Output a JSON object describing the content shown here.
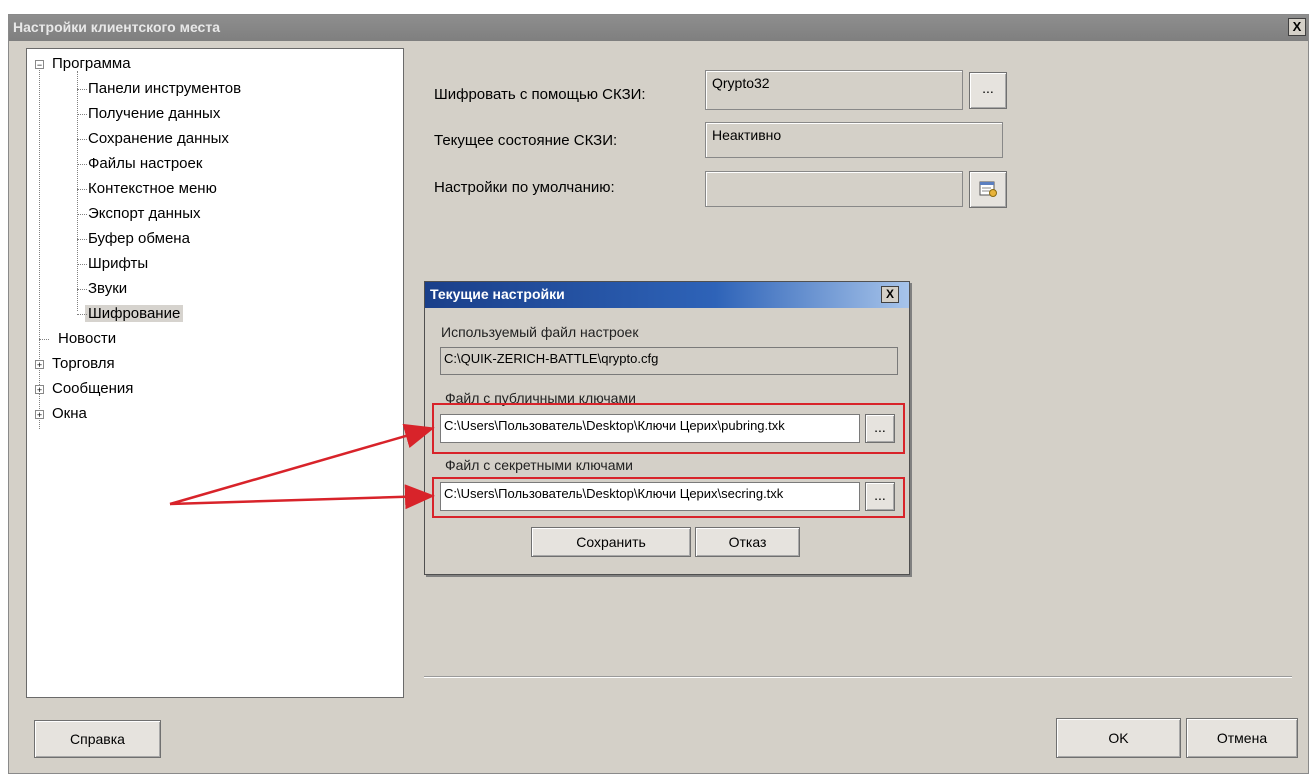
{
  "window": {
    "title": "Настройки клиентского места",
    "close_label": "X"
  },
  "tree": {
    "items": [
      {
        "label": "Программа",
        "expander": "−"
      },
      {
        "label": "Панели инструментов"
      },
      {
        "label": "Получение данных"
      },
      {
        "label": "Сохранение данных"
      },
      {
        "label": "Файлы настроек"
      },
      {
        "label": "Контекстное меню"
      },
      {
        "label": "Экспорт данных"
      },
      {
        "label": "Буфер обмена"
      },
      {
        "label": "Шрифты"
      },
      {
        "label": "Звуки"
      },
      {
        "label": "Шифрование",
        "selected": true
      },
      {
        "label": "Новости"
      },
      {
        "label": "Торговля",
        "expander": "+"
      },
      {
        "label": "Сообщения",
        "expander": "+"
      },
      {
        "label": "Окна",
        "expander": "+"
      }
    ]
  },
  "settings": {
    "encrypt_label": "Шифровать с помощью СКЗИ:",
    "encrypt_value": "Qrypto32",
    "browse_label": "...",
    "state_label": "Текущее состояние СКЗИ:",
    "state_value": "Неактивно",
    "default_label": "Настройки по умолчанию:",
    "default_value": "",
    "config_icon": "settings-card-icon"
  },
  "footer": {
    "help_label": "Справка",
    "ok_label": "OK",
    "cancel_label": "Отмена"
  },
  "dialog": {
    "title": "Текущие настройки",
    "close_label": "X",
    "used_file_label": "Используемый файл настроек",
    "used_file_value": "C:\\QUIK-ZERICH-BATTLE\\qrypto.cfg",
    "public_keys_label": "Файл с публичными ключами",
    "public_keys_value": "C:\\Users\\Пользователь\\Desktop\\Ключи Церих\\pubring.txk",
    "secret_keys_label": "Файл с секретными ключами",
    "secret_keys_value": "C:\\Users\\Пользователь\\Desktop\\Ключи Церих\\secring.txk",
    "browse_label": "...",
    "save_label": "Сохранить",
    "cancel_label": "Отказ"
  },
  "annotation": {
    "highlight_color": "#d8232a"
  }
}
